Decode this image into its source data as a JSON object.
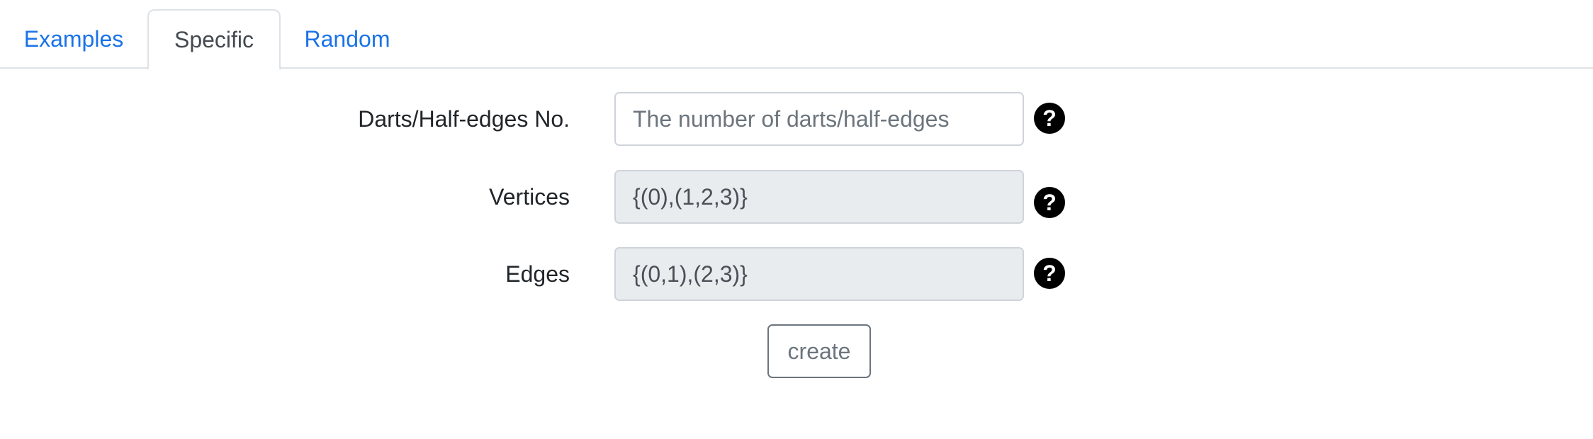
{
  "tabs": [
    {
      "label": "Examples",
      "active": false
    },
    {
      "label": "Specific",
      "active": true
    },
    {
      "label": "Random",
      "active": false
    }
  ],
  "form": {
    "darts": {
      "label": "Darts/Half-edges No.",
      "value": "",
      "placeholder": "The number of darts/half-edges",
      "help": "?"
    },
    "vertices": {
      "label": "Vertices",
      "value": "{(0),(1,2,3)}",
      "help": "?"
    },
    "edges": {
      "label": "Edges",
      "value": "{(0,1),(2,3)}",
      "help": "?"
    },
    "create_label": "create"
  },
  "colors": {
    "link": "#1a73e8",
    "help_icon_bg": "#000000",
    "readonly_bg": "#e9ecef",
    "border": "#ced4da"
  }
}
